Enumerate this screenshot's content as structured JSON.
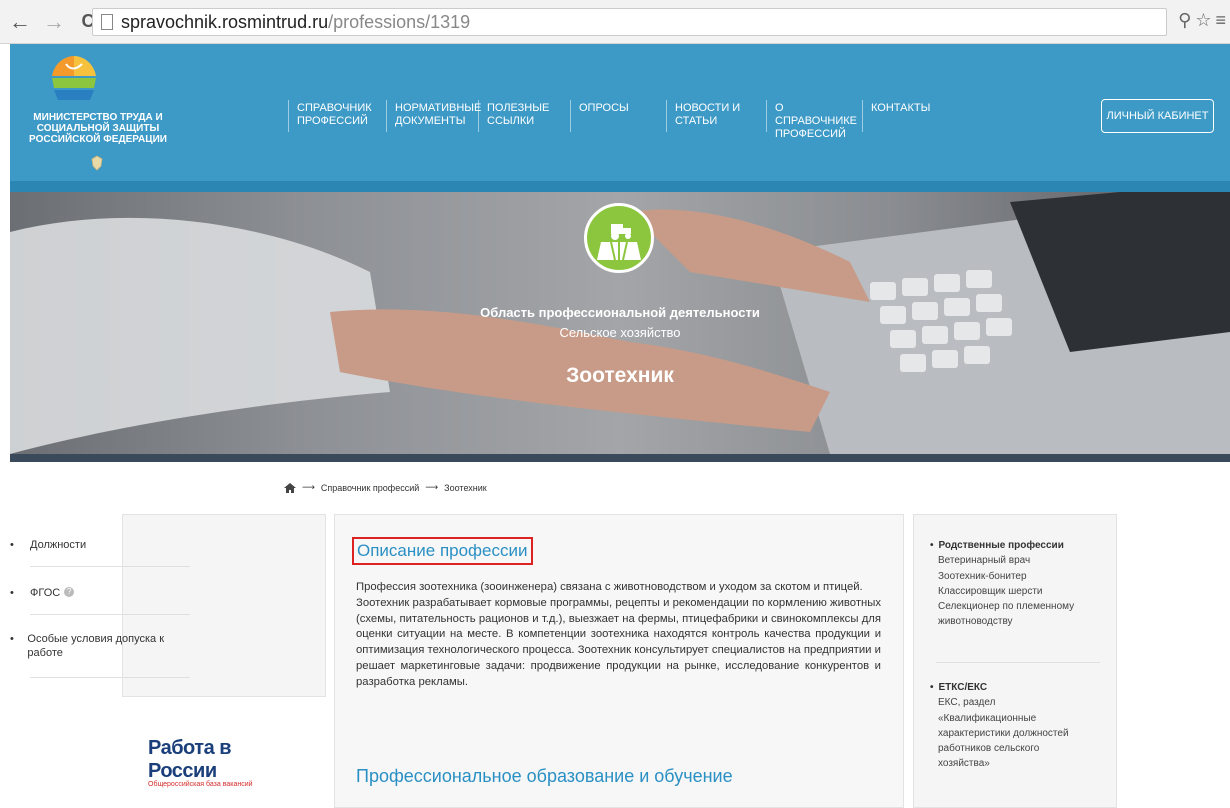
{
  "browser": {
    "url_domain": "spravochnik.rosmintrud.ru",
    "url_path": "/professions/1319"
  },
  "header": {
    "ministry_name": "МИНИСТЕРСТВО ТРУДА И СОЦИАЛЬНОЙ ЗАЩИТЫ РОССИЙСКОЙ ФЕДЕРАЦИИ",
    "nav": [
      {
        "label": "СПРАВОЧНИК ПРОФЕССИЙ"
      },
      {
        "label": "НОРМАТИВНЫЕ ДОКУМЕНТЫ"
      },
      {
        "label": "ПОЛЕЗНЫЕ ССЫЛКИ"
      },
      {
        "label": "ОПРОСЫ"
      },
      {
        "label": "НОВОСТИ И СТАТЬИ"
      },
      {
        "label": "О СПРАВОЧНИКЕ ПРОФЕССИЙ"
      },
      {
        "label": "КОНТАКТЫ"
      }
    ],
    "cabinet_label": "ЛИЧНЫЙ КАБИНЕТ"
  },
  "hero": {
    "area_label": "Область профессиональной деятельности",
    "area_value": "Сельское хозяйство",
    "profession": "Зоотехник"
  },
  "breadcrumb": {
    "sep": "⟶",
    "items": [
      "Справочник профессий",
      "Зоотехник"
    ]
  },
  "left_menu": {
    "items": [
      {
        "label": "Должности"
      },
      {
        "label": "ФГОС"
      },
      {
        "label": "Особые условия допуска к работе"
      }
    ],
    "info_glyph": "?"
  },
  "rabota": {
    "title": "Работа в России",
    "subtitle": "Общероссийская база вакансий"
  },
  "main": {
    "section1_title": "Описание профессии",
    "para1": "Профессия зоотехника (зооинженера) связана с животноводством и уходом за скотом и птицей.",
    "para2": "Зоотехник разрабатывает кормовые программы, рецепты и рекомендации по кормлению животных (схемы, питательность рационов и т.д.), выезжает на фермы, птицефабрики и свинокомплексы для оценки ситуации на месте. В компетенции зоотехника находятся контроль качества продукции и оптимизация технологического процесса. Зоотехник консультирует специалистов на предприятии и решает маркетинговые задачи: продвижение продукции на рынке, исследование конкурентов и разработка рекламы.",
    "section2_title": "Профессиональное образование и обучение"
  },
  "right": {
    "related_title": "Родственные профессии",
    "related": [
      "Ветеринарный врач",
      "Зоотехник-бонитер",
      "Классировщик шерсти",
      "Селекционер по племенному",
      "животноводству"
    ],
    "etks_title": "ЕТКС/ЕКС",
    "etks_lines": [
      "ЕКС, раздел",
      "«Квалификационные",
      "характеристики должностей",
      "работников сельского",
      "хозяйства»"
    ]
  },
  "colors": {
    "header_blue": "#3d9ac6",
    "link_blue": "#2a90c4",
    "badge_green": "#8cc63f",
    "highlight_red": "#dd2222"
  }
}
